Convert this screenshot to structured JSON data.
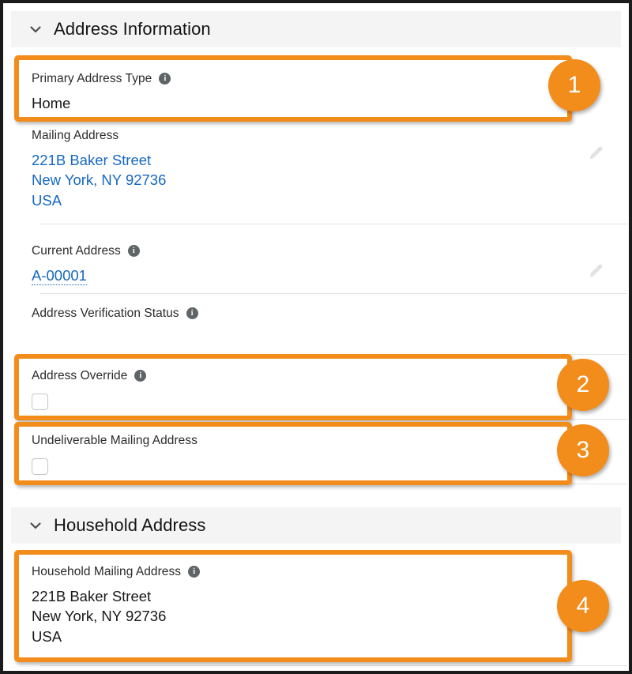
{
  "sections": [
    {
      "id": "address-information",
      "title": "Address Information",
      "chevron_icon": "chevron-down-icon",
      "fields": [
        {
          "id": "primary-address-type",
          "label": "Primary Address Type",
          "has_info": true,
          "info_icon": "info-icon",
          "value": "Home",
          "type": "text",
          "editable": false
        },
        {
          "id": "mailing-address",
          "label": "Mailing Address",
          "has_info": false,
          "type": "address-link",
          "lines": [
            "221B Baker Street",
            "New York, NY 92736",
            "USA"
          ],
          "editable": true,
          "edit_icon": "pencil-icon"
        },
        {
          "id": "current-address",
          "label": "Current Address",
          "has_info": true,
          "info_icon": "info-icon",
          "type": "lookup",
          "value": "A-00001",
          "editable": true,
          "edit_icon": "pencil-icon"
        },
        {
          "id": "address-verification-status",
          "label": "Address Verification Status",
          "has_info": true,
          "info_icon": "info-icon",
          "type": "text",
          "value": "",
          "editable": false
        },
        {
          "id": "address-override",
          "label": "Address Override",
          "has_info": true,
          "info_icon": "info-icon",
          "type": "checkbox",
          "checked": false
        },
        {
          "id": "undeliverable-mailing-address",
          "label": "Undeliverable Mailing Address",
          "has_info": false,
          "type": "checkbox",
          "checked": false
        }
      ]
    },
    {
      "id": "household-address",
      "title": "Household Address",
      "chevron_icon": "chevron-down-icon",
      "fields": [
        {
          "id": "household-mailing-address",
          "label": "Household Mailing Address",
          "has_info": true,
          "info_icon": "info-icon",
          "type": "address-text",
          "lines": [
            "221B Baker Street",
            "New York, NY 92736",
            "USA"
          ],
          "editable": false
        }
      ]
    }
  ],
  "annotations": {
    "accent_color": "#f28c1a",
    "badges": [
      {
        "number": "1",
        "target": "primary-address-type"
      },
      {
        "number": "2",
        "target": "address-override"
      },
      {
        "number": "3",
        "target": "undeliverable-mailing-address"
      },
      {
        "number": "4",
        "target": "household-mailing-address"
      }
    ]
  },
  "colors": {
    "link": "#1668c1",
    "accent": "#f28c1a",
    "section_header_bg": "#f4f4f4",
    "text": "#181818",
    "label": "#2b2b2b",
    "divider": "#e2e2e2",
    "info_badge": "#5f6466"
  }
}
